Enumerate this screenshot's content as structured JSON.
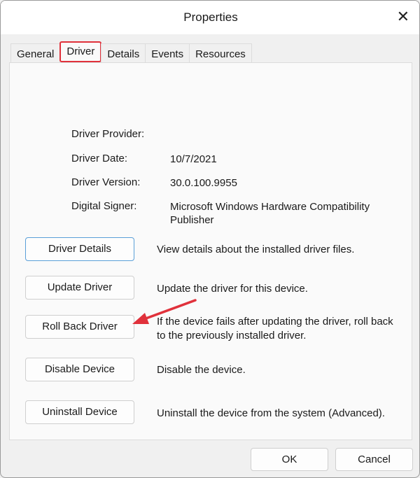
{
  "window": {
    "title": "Properties",
    "close_icon": "close-icon"
  },
  "tabs": [
    {
      "label": "General"
    },
    {
      "label": "Driver"
    },
    {
      "label": "Details"
    },
    {
      "label": "Events"
    },
    {
      "label": "Resources"
    }
  ],
  "info": [
    {
      "label": "Driver Provider:",
      "value": ""
    },
    {
      "label": "Driver Date:",
      "value": "10/7/2021"
    },
    {
      "label": "Driver Version:",
      "value": "30.0.100.9955"
    },
    {
      "label": "Digital Signer:",
      "value": "Microsoft Windows Hardware Compatibility Publisher"
    }
  ],
  "actions": [
    {
      "button": "Driver Details",
      "desc": "View details about the installed driver files."
    },
    {
      "button": "Update Driver",
      "desc": "Update the driver for this device."
    },
    {
      "button": "Roll Back Driver",
      "desc": "If the device fails after updating the driver, roll back to the previously installed driver."
    },
    {
      "button": "Disable Device",
      "desc": "Disable the device."
    },
    {
      "button": "Uninstall Device",
      "desc": "Uninstall the device from the system (Advanced)."
    }
  ],
  "footer": {
    "ok": "OK",
    "cancel": "Cancel"
  },
  "colors": {
    "highlight": "#e0313b",
    "default_button_border": "#5a9fd8"
  }
}
